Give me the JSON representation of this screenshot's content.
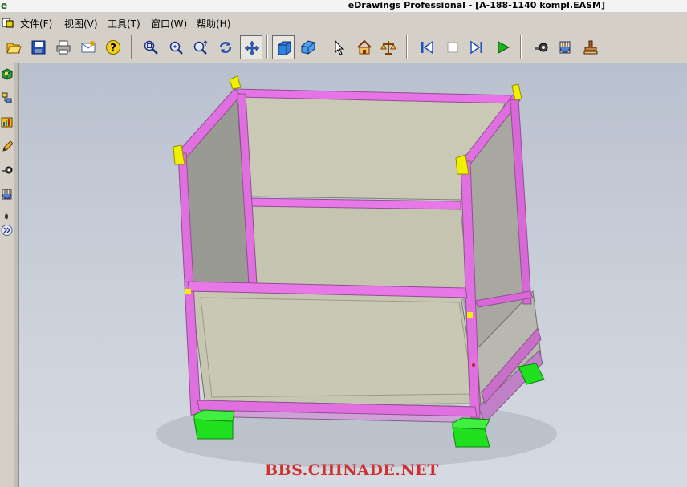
{
  "window": {
    "app_icon": "e",
    "title": "eDrawings Professional - [A-188-1140 kompl.EASM]"
  },
  "menu": {
    "items": [
      "文件(F)",
      "视图(V)",
      "工具(T)",
      "窗口(W)",
      "帮助(H)"
    ]
  },
  "toolbar": {
    "buttons": [
      {
        "name": "open",
        "icon": "folder-open-icon"
      },
      {
        "name": "save",
        "icon": "save-icon"
      },
      {
        "name": "print",
        "icon": "printer-icon"
      },
      {
        "name": "send",
        "icon": "mail-icon"
      },
      {
        "name": "help",
        "icon": "help-icon"
      },
      {
        "name": "zoom-fit",
        "icon": "zoom-fit-icon"
      },
      {
        "name": "zoom-area",
        "icon": "zoom-area-icon"
      },
      {
        "name": "zoom",
        "icon": "zoom-icon"
      },
      {
        "name": "rotate",
        "icon": "rotate-icon"
      },
      {
        "name": "pan",
        "icon": "pan-icon",
        "pressed": true
      },
      {
        "name": "shaded",
        "icon": "shaded-box-icon",
        "pressed": true
      },
      {
        "name": "perspective",
        "icon": "perspective-box-icon"
      },
      {
        "name": "select",
        "icon": "cursor-icon"
      },
      {
        "name": "home",
        "icon": "home-icon"
      },
      {
        "name": "measure",
        "icon": "measure-icon"
      },
      {
        "name": "first",
        "icon": "skip-first-icon"
      },
      {
        "name": "stop",
        "icon": "stop-icon"
      },
      {
        "name": "last",
        "icon": "skip-last-icon"
      },
      {
        "name": "play",
        "icon": "play-icon"
      },
      {
        "name": "measure-tool",
        "icon": "tape-measure-icon"
      },
      {
        "name": "section",
        "icon": "section-icon"
      },
      {
        "name": "stamp",
        "icon": "stamp-icon"
      }
    ]
  },
  "sidebar": {
    "buttons": [
      {
        "name": "components",
        "icon": "components-icon"
      },
      {
        "name": "configurations",
        "icon": "config-icon"
      },
      {
        "name": "animations",
        "icon": "animation-icon"
      },
      {
        "name": "markup",
        "icon": "pencil-icon"
      },
      {
        "name": "measure",
        "icon": "measure-small-icon"
      },
      {
        "name": "section",
        "icon": "section-small-icon"
      },
      {
        "name": "dot",
        "icon": "dot-icon"
      },
      {
        "name": "expand",
        "icon": "double-chevron-right-icon"
      }
    ]
  },
  "viewport": {
    "model": "pallet-cage-3d",
    "watermark": "BBS.CHINADE.NET",
    "colors": {
      "frame_pink": "#e070e0",
      "panel_gray": "#c8c8b4",
      "corner_yellow": "#f0f000",
      "foot_green": "#20e020",
      "background": "#c8ced8"
    }
  }
}
